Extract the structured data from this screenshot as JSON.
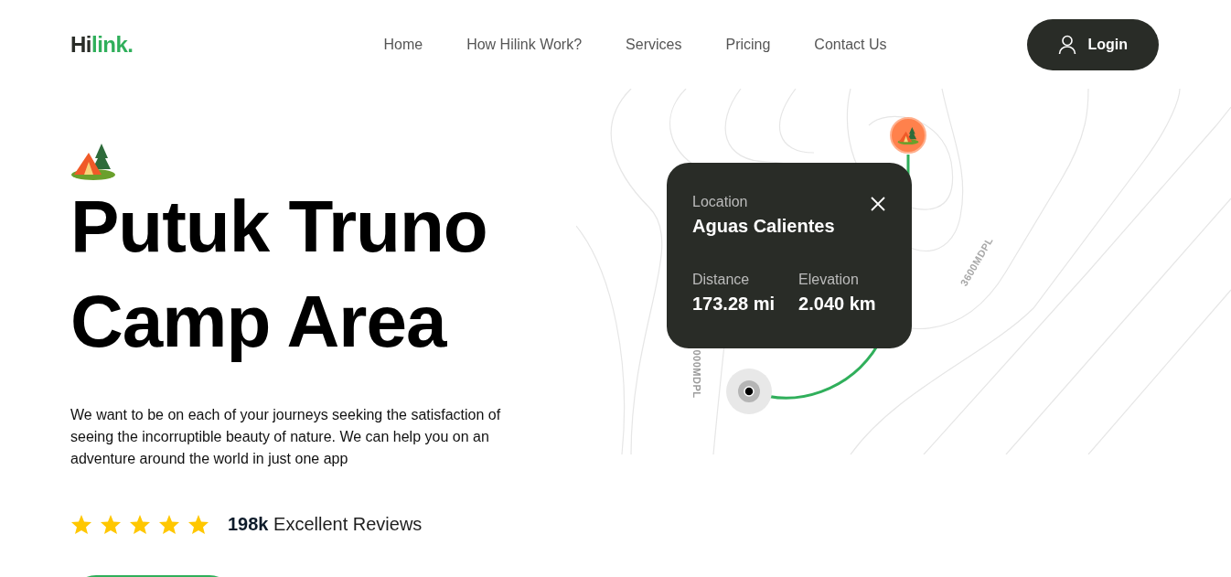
{
  "logo": {
    "lead": "Hi",
    "accent": "link."
  },
  "nav": {
    "links": [
      "Home",
      "How Hilink Work?",
      "Services",
      "Pricing",
      "Contact Us"
    ],
    "login": "Login"
  },
  "hero": {
    "title_lines": [
      "Putuk Truno",
      "Camp Area"
    ],
    "description": "We want to be on each of your journeys seeking the satisfaction of seeing the incorruptible beauty of nature. We can help you on an adventure around the world in just one app",
    "rating": {
      "stars": 5,
      "text": "**198k** Excellent Reviews"
    }
  },
  "map": {
    "labels": [
      "3600MDPL",
      "000MDPL"
    ],
    "card": {
      "location_label": "Location",
      "location": "Aguas Calientes",
      "stats": [
        {
          "label": "Distance",
          "value": "173.28 mi"
        },
        {
          "label": "Elevation",
          "value": "2.040 km"
        }
      ]
    }
  }
}
